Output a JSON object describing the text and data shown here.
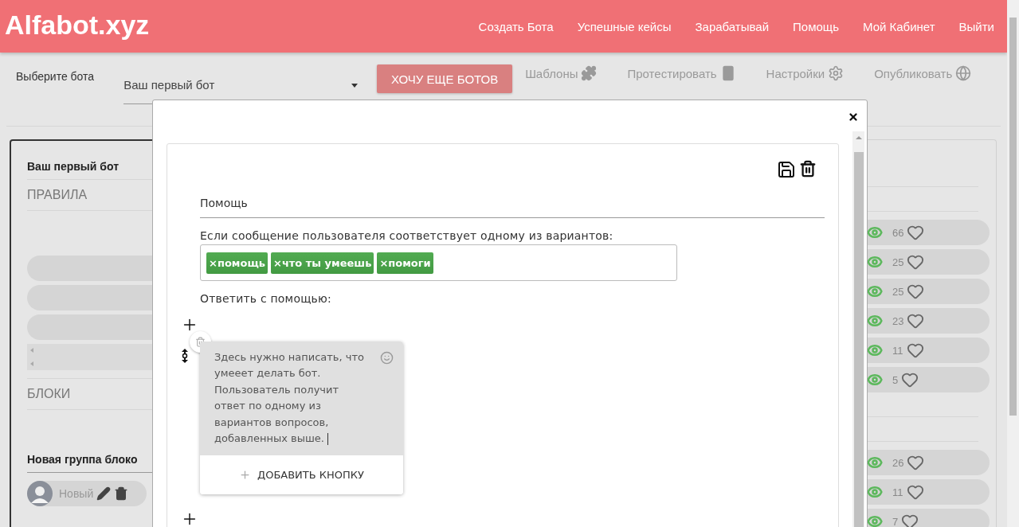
{
  "header": {
    "logo": "Alfabot.xyz",
    "nav": [
      {
        "label": "Создать Бота"
      },
      {
        "label": "Успешные кейсы"
      },
      {
        "label": "Зарабатывай"
      },
      {
        "label": "Помощь"
      },
      {
        "label": "Мой Кабинет"
      },
      {
        "label": "Выйти"
      }
    ]
  },
  "toolbar": {
    "select_label": "Выберите бота",
    "select_value": "Ваш первый бот",
    "cta": "ХОЧУ ЕЩЕ БОТОВ",
    "links": [
      {
        "label": "Шаблоны"
      },
      {
        "label": "Протестировать"
      },
      {
        "label": "Настройки"
      },
      {
        "label": "Опубликовать"
      }
    ]
  },
  "left_panel": {
    "title": "Ваш первый бот",
    "rules_heading": "ПРАВИЛА",
    "blocks_heading": "БЛОКИ",
    "group_title": "Новая группа блоко",
    "block_label": "Новый"
  },
  "right_panel": {
    "groups": [
      [
        {
          "views": "66"
        },
        {
          "views": "25"
        },
        {
          "views": "25"
        },
        {
          "views": "23"
        },
        {
          "views": "11"
        },
        {
          "views": "5"
        }
      ],
      [
        {
          "views": "26"
        },
        {
          "views": "11"
        },
        {
          "views": "7"
        }
      ]
    ]
  },
  "modal": {
    "rule_name": "Помощь",
    "match_label": "Если сообщение пользователя соответствует одному из вариантов:",
    "tags": [
      {
        "remove": "×",
        "label": "помощь"
      },
      {
        "remove": "×",
        "label": "что ты умеешь"
      },
      {
        "remove": "×",
        "label": "помоги"
      }
    ],
    "reply_label": "Ответить с помощью:",
    "message": {
      "text": "Здесь нужно написать, что умееет делать бот. Пользователь получит ответ по одному из вариантов вопросов, добавленных выше.",
      "button": "ДОБАВИТЬ КНОПКУ"
    }
  }
}
